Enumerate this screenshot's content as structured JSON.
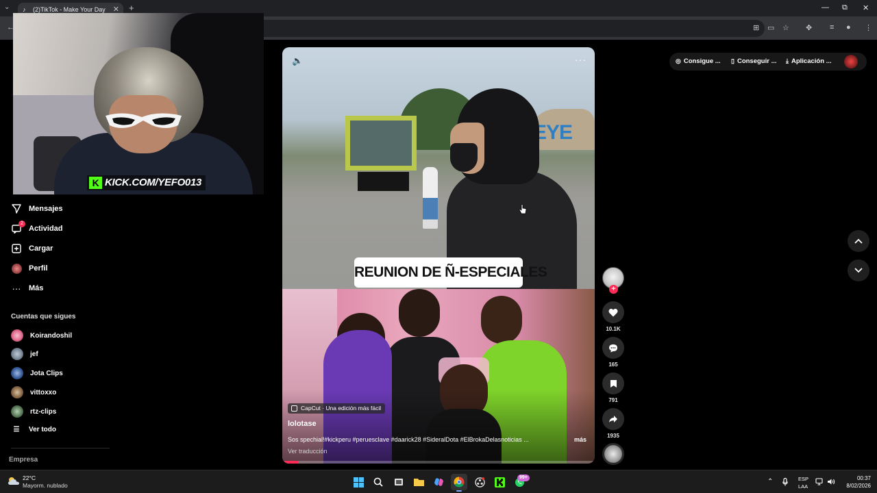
{
  "browser": {
    "tab_title": "(2)TikTok - Make Your Day",
    "tab_close": "✕",
    "new_tab": "+",
    "win_minimize": "—",
    "win_restore": "⧉",
    "win_close": "✕"
  },
  "webcam": {
    "overlay_text": "KICK.COM/YEFO013",
    "overlay_logo": "K"
  },
  "sidebar": {
    "nav": [
      {
        "label": "Mensajes",
        "icon": "send-icon"
      },
      {
        "label": "Actividad",
        "icon": "inbox-icon",
        "badge": "2"
      },
      {
        "label": "Cargar",
        "icon": "upload-icon"
      },
      {
        "label": "Perfil",
        "icon": "profile-avatar"
      },
      {
        "label": "Más",
        "icon": "more-icon"
      }
    ],
    "following_heading": "Cuentas que sigues",
    "accounts": [
      {
        "name": "Koirandoshil",
        "color": "#e36a8e"
      },
      {
        "name": "jef",
        "color": "#7a8a9a"
      },
      {
        "name": "Jota Clips",
        "color": "#3a5f9f"
      },
      {
        "name": "vittoxxo",
        "color": "#8a6a4a"
      },
      {
        "name": "rtz-clips",
        "color": "#5a7a5a"
      }
    ],
    "see_all": "Ver todo",
    "company": "Empresa"
  },
  "video": {
    "caption": "REUNION DE Ñ-ESPECIALES",
    "capcut_label": "CapCut · Una edición más fácil",
    "username": "lolotase",
    "description": "Sos spechial!#kickperu #peruesclave #daarick28 #SideralDota #ElBrokaDelasnoticias ...",
    "more": "más",
    "translate": "Ver traducción",
    "progress_fraction": 0.05,
    "mute_icon": "🔈",
    "more_icon": "···"
  },
  "actions": {
    "likes": "10.1K",
    "comments": "165",
    "saves": "791",
    "shares": "1935",
    "follow_plus": "+"
  },
  "topbar": {
    "btn1": "Consigue ...",
    "btn2": "Conseguir ...",
    "btn3": "Aplicación ..."
  },
  "taskbar": {
    "temp": "22°C",
    "condition": "Mayorm. nublado",
    "lang_line1": "ESP",
    "lang_line2": "LAA",
    "time": "00:37",
    "date": "8/02/2026",
    "whatsapp_badge": "99+"
  },
  "colors": {
    "accent": "#fe2c55",
    "kick_green": "#53fc18"
  }
}
